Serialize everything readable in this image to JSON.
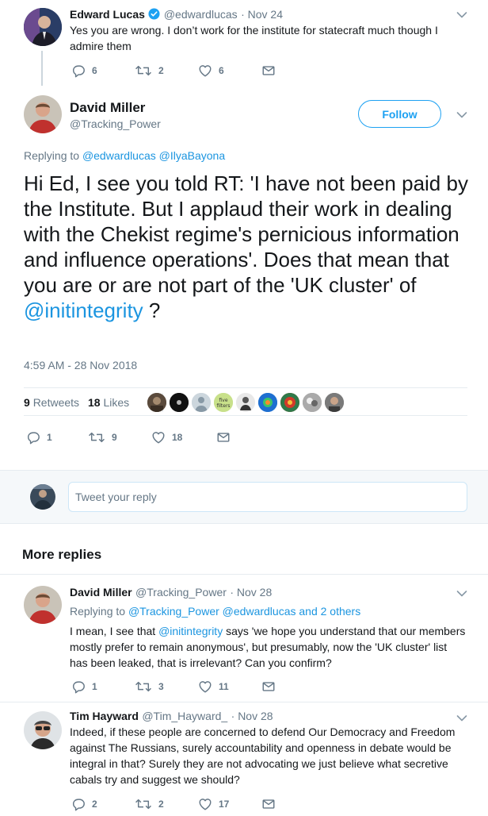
{
  "colors": {
    "link": "#1b95e0",
    "accent": "#1da1f2",
    "muted": "#657786",
    "verified": "#1da1f2"
  },
  "tweet1": {
    "name": "Edward Lucas",
    "handle": "@edwardlucas",
    "date": "· Nov 24",
    "text": "Yes you are wrong. I don’t work for the institute for statecraft much though I admire them",
    "replies": "6",
    "retweets": "2",
    "likes": "6"
  },
  "main": {
    "name": "David Miller",
    "handle": "@Tracking_Power",
    "follow_label": "Follow",
    "replying_prefix": "Replying to",
    "replying_to_1": "@edwardlucas",
    "replying_to_2": "@IlyaBayona",
    "text": "Hi Ed, I see you told RT: 'I have not been paid by the Institute. But I applaud their work in dealing with the Chekist regime's pernicious information and influence operations'.  Does that mean that you are or are not part of the 'UK cluster' of",
    "mention": "@initintegrity",
    "text_end": " ?",
    "timestamp": "4:59 AM - 28 Nov 2018",
    "retweets_count": "9",
    "retweets_label": "Retweets",
    "likes_count": "18",
    "likes_label": "Likes",
    "likers": [
      "avatar-1",
      "avatar-2",
      "avatar-3",
      "five filters",
      "avatar-5",
      "avatar-6",
      "avatar-7",
      "avatar-8",
      "avatar-9"
    ],
    "replies": "1",
    "retweets": "9",
    "likes": "18"
  },
  "reply_box": {
    "placeholder": "Tweet your reply"
  },
  "more_replies": {
    "title": "More replies"
  },
  "reply1": {
    "name": "David Miller",
    "handle": "@Tracking_Power",
    "date": "· Nov 28",
    "replying_prefix": "Replying to",
    "replying_to_1": "@Tracking_Power",
    "replying_to_2": "@edwardlucas",
    "replying_suffix": "and 2 others",
    "text_start": "I mean, I see that",
    "mention": "@initintegrity",
    "text_end": "says 'we hope you understand that our members mostly prefer to remain anonymous', but presumably, now the 'UK cluster' list has been leaked, that is irrelevant? Can you confirm?",
    "replies": "1",
    "retweets": "3",
    "likes": "11"
  },
  "reply2": {
    "name": "Tim Hayward",
    "handle": "@Tim_Hayward_",
    "date": "· Nov 28",
    "text": "Indeed, if these people are concerned to defend Our Democracy and Freedom against The Russians, surely accountability and openness in debate would be integral in that? Surely they are not advocating we just believe what secretive cabals try and suggest we should?",
    "replies": "2",
    "retweets": "2",
    "likes": "17"
  }
}
